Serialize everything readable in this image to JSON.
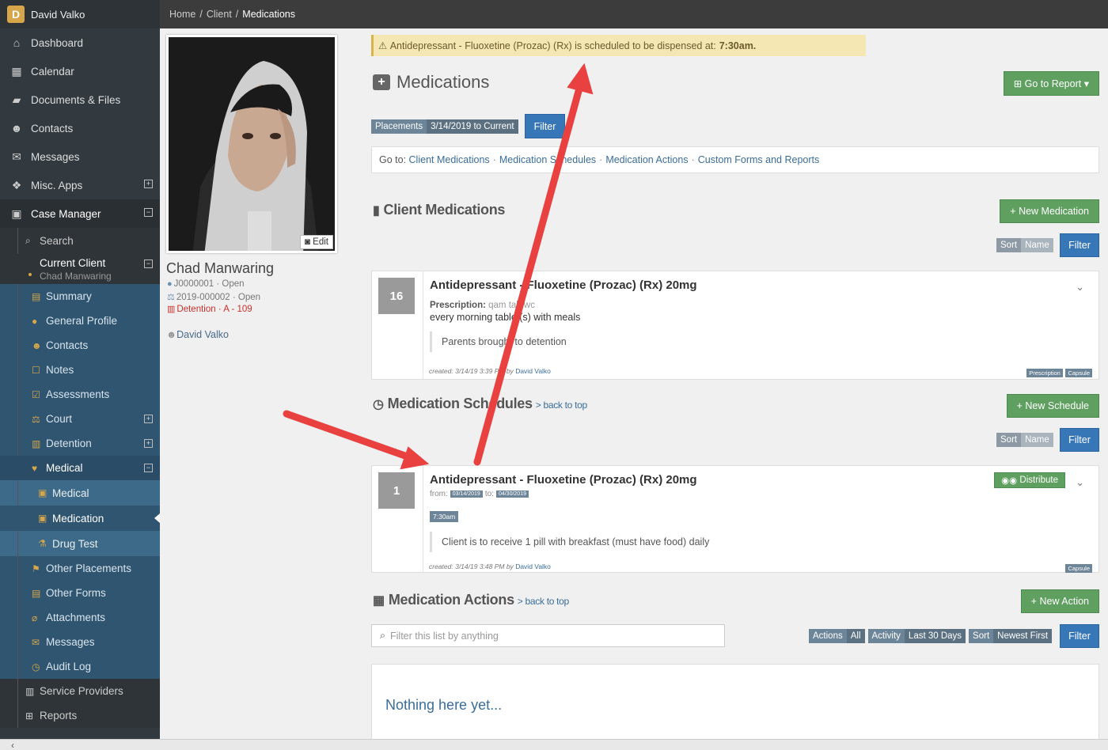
{
  "user": {
    "initial": "D",
    "name": "David Valko"
  },
  "nav": {
    "items": [
      {
        "label": "Dashboard",
        "icon": "home-icon"
      },
      {
        "label": "Calendar",
        "icon": "calendar-icon"
      },
      {
        "label": "Documents & Files",
        "icon": "folder-icon"
      },
      {
        "label": "Contacts",
        "icon": "users-icon"
      },
      {
        "label": "Messages",
        "icon": "comments-icon"
      },
      {
        "label": "Misc. Apps",
        "icon": "cubes-icon",
        "expand": "⊞"
      },
      {
        "label": "Case Manager",
        "icon": "briefcase-icon",
        "expand": "⊟"
      }
    ],
    "search": "Search",
    "current_client": {
      "label": "Current Client",
      "name": "Chad Manwaring"
    },
    "client_items": [
      "Summary",
      "General Profile",
      "Contacts",
      "Notes",
      "Assessments",
      "Court",
      "Detention",
      "Medical"
    ],
    "medical_sub": [
      "Medical",
      "Medication",
      "Drug Test"
    ],
    "client_items_after": [
      "Other Placements",
      "Other Forms",
      "Attachments",
      "Messages",
      "Audit Log"
    ],
    "bottom_items": [
      "Service Providers",
      "Reports"
    ]
  },
  "breadcrumb": {
    "home": "Home",
    "client": "Client",
    "current": "Medications"
  },
  "profile": {
    "edit": "Edit",
    "name": "Chad Manwaring",
    "case1": "J0000001 · Open",
    "case2": "2019-000002 · Open",
    "detention": "Detention · A - 109",
    "worker": "David Valko"
  },
  "alert": {
    "text": "Antidepressant - Fluoxetine (Prozac) (Rx) is scheduled to be dispensed at:",
    "time": "7:30am."
  },
  "page": {
    "title": "Medications",
    "report_button": "Go to Report",
    "placements_label": "Placements",
    "placements_range": "3/14/2019 to Current",
    "filter": "Filter"
  },
  "goto": {
    "label": "Go to:",
    "links": [
      "Client Medications",
      "Medication Schedules",
      "Medication Actions",
      "Custom Forms and Reports"
    ]
  },
  "client_medications": {
    "title": "Client Medications",
    "new_button": "New Medication",
    "sort": "Sort",
    "sort_by": "Name",
    "filter": "Filter",
    "card": {
      "num": "16",
      "title": "Antidepressant - Fluoxetine (Prozac) (Rx) 20mg",
      "prescription_label": "Prescription:",
      "prescription_code": "qam tab wc",
      "instructions": "every morning tablet(s) with meals",
      "note": "Parents brought to detention",
      "created_label": "created:",
      "created": "3/14/19 3:39 PM by",
      "created_by": "David Valko",
      "badges": [
        "Prescription",
        "Capsule"
      ]
    }
  },
  "schedules": {
    "title": "Medication Schedules",
    "back": "> back to top",
    "new_button": "New Schedule",
    "sort": "Sort",
    "sort_by": "Name",
    "filter": "Filter",
    "card": {
      "num": "1",
      "title": "Antidepressant - Fluoxetine (Prozac) (Rx) 20mg",
      "from_label": "from:",
      "from": "03/14/2019",
      "to_label": "to:",
      "to": "04/30/2019",
      "time": "7:30am",
      "distribute": "Distribute",
      "note": "Client is to receive 1 pill with breakfast (must have food) daily",
      "created_label": "created:",
      "created": "3/14/19 3:48 PM by",
      "created_by": "David Valko",
      "badge": "Capsule"
    }
  },
  "actions": {
    "title": "Medication Actions",
    "back": "> back to top",
    "new_button": "New Action",
    "filter_placeholder": "Filter this list by anything",
    "tags": [
      {
        "label": "Actions",
        "value": "All"
      },
      {
        "label": "Activity",
        "value": "Last 30 Days"
      },
      {
        "label": "Sort",
        "value": "Newest First"
      }
    ],
    "filter": "Filter",
    "empty": "Nothing here yet..."
  },
  "colors": {
    "sidebar": "#333a3f",
    "client_nav": "#2f5571",
    "green": "#5fa060",
    "blue": "#3776b7",
    "alert": "#f5e7b4",
    "annotation_arrow": "#e94040"
  }
}
